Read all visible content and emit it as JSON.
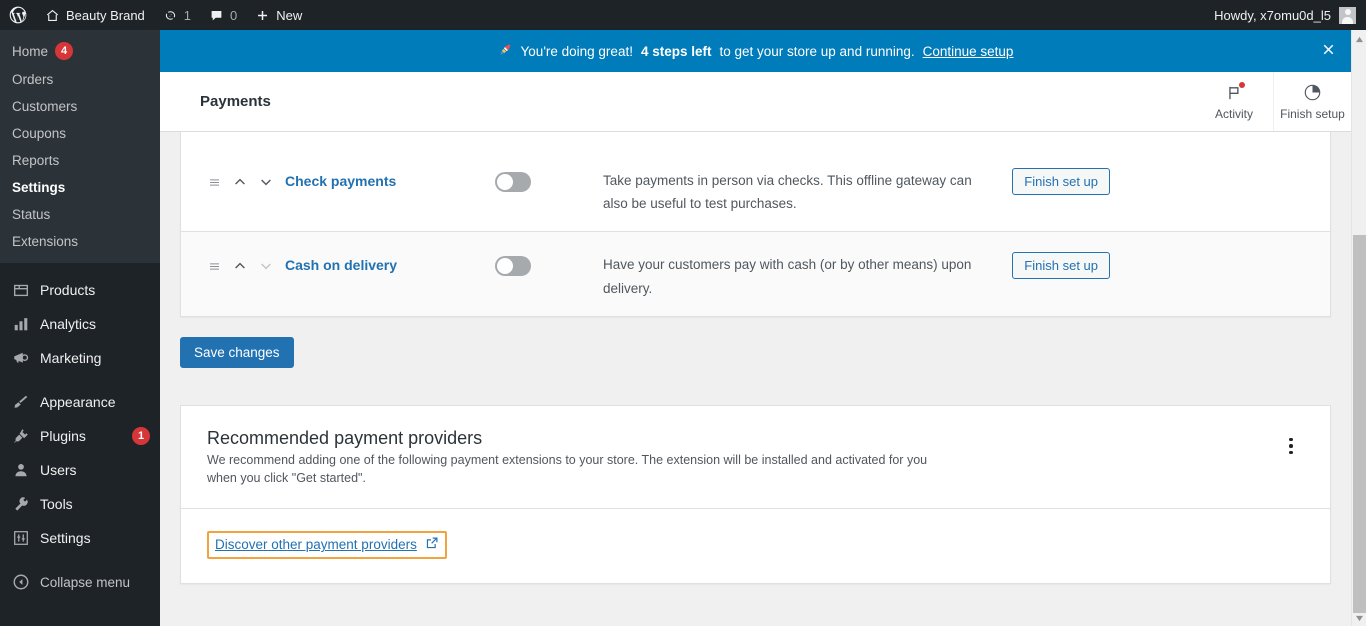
{
  "adminbar": {
    "logo_icon": "wordpress-logo-icon",
    "site_icon": "home-icon",
    "site_name": "Beauty Brand",
    "updates_icon": "updates-icon",
    "updates_count": "1",
    "comments_icon": "comment-bubble-icon",
    "comments_count": "0",
    "new_icon": "plus-icon",
    "new_label": "New",
    "howdy": "Howdy, x7omu0d_l5",
    "avatar_icon": "user-avatar-icon"
  },
  "sidebar": {
    "woocommerce": {
      "items": [
        {
          "label": "Home",
          "badge": "4",
          "current": false
        },
        {
          "label": "Orders",
          "badge": "",
          "current": false
        },
        {
          "label": "Customers",
          "badge": "",
          "current": false
        },
        {
          "label": "Coupons",
          "badge": "",
          "current": false
        },
        {
          "label": "Reports",
          "badge": "",
          "current": false
        },
        {
          "label": "Settings",
          "badge": "",
          "current": true
        },
        {
          "label": "Status",
          "badge": "",
          "current": false
        },
        {
          "label": "Extensions",
          "badge": "",
          "current": false
        }
      ]
    },
    "top_items": [
      {
        "label": "Products",
        "icon": "products-box-icon",
        "badge": ""
      },
      {
        "label": "Analytics",
        "icon": "bar-chart-icon",
        "badge": ""
      },
      {
        "label": "Marketing",
        "icon": "megaphone-icon",
        "badge": ""
      }
    ],
    "bottom_items": [
      {
        "label": "Appearance",
        "icon": "paintbrush-icon",
        "badge": ""
      },
      {
        "label": "Plugins",
        "icon": "plug-icon",
        "badge": "1"
      },
      {
        "label": "Users",
        "icon": "user-icon",
        "badge": ""
      },
      {
        "label": "Tools",
        "icon": "wrench-icon",
        "badge": ""
      },
      {
        "label": "Settings",
        "icon": "sliders-icon",
        "badge": ""
      }
    ],
    "collapse_label": "Collapse menu",
    "collapse_icon": "collapse-arrow-icon"
  },
  "notice": {
    "rocket_icon": "rocket-icon",
    "text_lead": "You're doing great!",
    "steps_left": "4 steps left",
    "text_tail": "to get your store up and running.",
    "link_label": "Continue setup",
    "dismiss_icon": "close-icon",
    "background": "#007cba"
  },
  "header": {
    "title": "Payments",
    "buttons": [
      {
        "label": "Activity",
        "icon": "flag-icon",
        "has_notification": true
      },
      {
        "label": "Finish setup",
        "icon": "progress-pie-icon",
        "has_notification": false
      }
    ]
  },
  "payments": {
    "rows": [
      {
        "drag_icon": "drag-handle-icon",
        "up_icon": "chevron-up-icon",
        "down_icon": "chevron-down-icon",
        "down_disabled": false,
        "title": "Check payments",
        "enabled": false,
        "description": "Take payments in person via checks. This offline gateway can also be useful to test purchases.",
        "action_label": "Finish set up"
      },
      {
        "drag_icon": "drag-handle-icon",
        "up_icon": "chevron-up-icon",
        "down_icon": "chevron-down-icon",
        "down_disabled": true,
        "title": "Cash on delivery",
        "enabled": false,
        "description": "Have your customers pay with cash (or by other means) upon delivery.",
        "action_label": "Finish set up"
      }
    ],
    "save_label": "Save changes"
  },
  "recommended": {
    "title": "Recommended payment providers",
    "subtitle": "We recommend adding one of the following payment extensions to your store. The extension will be installed and activated for you when you click \"Get started\".",
    "kebab_icon": "more-options-icon",
    "discover_label": "Discover other payment providers",
    "discover_icon": "external-link-icon",
    "focus_outline_color": "#f0a33e"
  },
  "scrollbar": {
    "up_icon": "scroll-up-arrow-icon",
    "down_icon": "scroll-down-arrow-icon"
  },
  "colors": {
    "admin_bg": "#1d2327",
    "submenu_bg": "#2c3338",
    "accent_blue": "#2271b1",
    "notice_blue": "#007cba",
    "badge_red": "#d63638"
  }
}
